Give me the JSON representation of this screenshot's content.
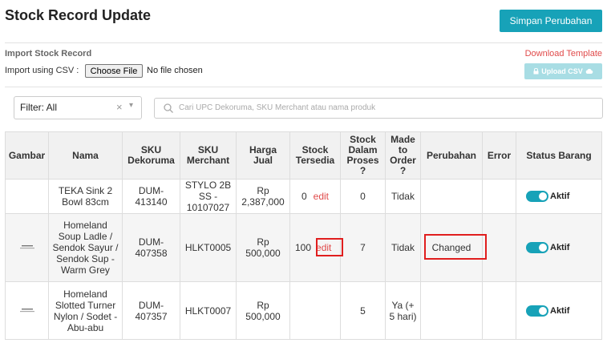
{
  "page": {
    "title": "Stock Record Update",
    "save_label": "Simpan Perubahan"
  },
  "import": {
    "section_title": "Import Stock Record",
    "csv_label": "Import using CSV :",
    "choose_file_label": "Choose File",
    "file_status": "No file chosen",
    "download_template": "Download Template",
    "upload_csv_label": "Upload CSV"
  },
  "filter": {
    "value": "Filter: All",
    "clear_glyph": "×",
    "arrow_glyph": "▾"
  },
  "search": {
    "placeholder": "Cari UPC Dekoruma, SKU Merchant atau nama produk"
  },
  "table": {
    "headers": {
      "gambar": "Gambar",
      "nama": "Nama",
      "sku_dekoruma": "SKU Dekoruma",
      "sku_merchant": "SKU Merchant",
      "harga_jual": "Harga Jual",
      "stock_tersedia": "Stock Tersedia",
      "stock_dalam_proses": "Stock Dalam Proses ?",
      "made_to_order": "Made to Order ?",
      "perubahan": "Perubahan",
      "error": "Error",
      "status_barang": "Status Barang"
    },
    "edit_label": "edit",
    "rows": [
      {
        "nama": "TEKA Sink 2 Bowl 83cm",
        "sku_dekoruma": "DUM-413140",
        "sku_merchant": "STYLO 2B SS - 10107027",
        "harga": "Rp 2,387,000",
        "stock": "0",
        "proses": "0",
        "mto": "Tidak",
        "perubahan": "",
        "error": "",
        "status": "Aktif"
      },
      {
        "nama": "Homeland Soup Ladle / Sendok Sayur / Sendok Sup - Warm Grey",
        "sku_dekoruma": "DUM-407358",
        "sku_merchant": "HLKT0005",
        "harga": "Rp 500,000",
        "stock": "100",
        "proses": "7",
        "mto": "Tidak",
        "perubahan": "Changed",
        "error": "",
        "status": "Aktif"
      },
      {
        "nama": "Homeland Slotted Turner Nylon / Sodet - Abu-abu",
        "sku_dekoruma": "DUM-407357",
        "sku_merchant": "HLKT0007",
        "harga": "Rp 500,000",
        "stock": "",
        "proses": "5",
        "mto": "Ya (+ 5 hari)",
        "perubahan": "",
        "error": "",
        "status": "Aktif"
      }
    ]
  },
  "colors": {
    "primary": "#17a2b8",
    "link_red": "#e04a4a",
    "highlight": "#e01e1e"
  }
}
